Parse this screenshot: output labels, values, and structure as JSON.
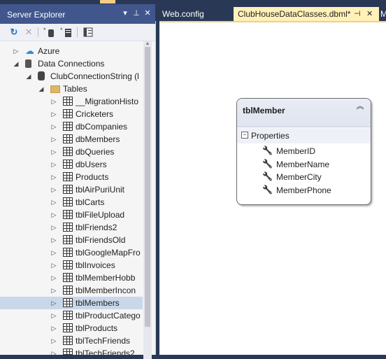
{
  "server_explorer": {
    "title": "Server Explorer",
    "title_buttons": [
      "▾",
      "⊥",
      "✕"
    ],
    "toolbar": [
      "refresh-icon",
      "stop-icon",
      "connect-db-icon",
      "connect-server-icon",
      "properties-icon"
    ],
    "tree": [
      {
        "label": "Azure",
        "level": 0,
        "expanded": false,
        "icon": "azure-icon"
      },
      {
        "label": "Data Connections",
        "level": 0,
        "expanded": true,
        "icon": "data-connections-icon"
      },
      {
        "label": "ClubConnectionString (l",
        "level": 1,
        "expanded": true,
        "icon": "database-icon"
      },
      {
        "label": "Tables",
        "level": 2,
        "expanded": true,
        "icon": "folder-icon"
      },
      {
        "label": "__MigrationHisto",
        "level": 3,
        "icon": "table-icon"
      },
      {
        "label": "Cricketers",
        "level": 3,
        "icon": "table-icon"
      },
      {
        "label": "dbCompanies",
        "level": 3,
        "icon": "table-icon"
      },
      {
        "label": "dbMembers",
        "level": 3,
        "icon": "table-icon"
      },
      {
        "label": "dbQueries",
        "level": 3,
        "icon": "table-icon"
      },
      {
        "label": "dbUsers",
        "level": 3,
        "icon": "table-icon"
      },
      {
        "label": "Products",
        "level": 3,
        "icon": "table-icon"
      },
      {
        "label": "tblAirPuriUnit",
        "level": 3,
        "icon": "table-icon"
      },
      {
        "label": "tblCarts",
        "level": 3,
        "icon": "table-icon"
      },
      {
        "label": "tblFileUpload",
        "level": 3,
        "icon": "table-icon"
      },
      {
        "label": "tblFriends2",
        "level": 3,
        "icon": "table-icon"
      },
      {
        "label": "tblFriendsOld",
        "level": 3,
        "icon": "table-icon"
      },
      {
        "label": "tblGoogleMapFro",
        "level": 3,
        "icon": "table-icon"
      },
      {
        "label": "tblInvoices",
        "level": 3,
        "icon": "table-icon"
      },
      {
        "label": "tblMemberHobb",
        "level": 3,
        "icon": "table-icon"
      },
      {
        "label": "tblMemberIncon",
        "level": 3,
        "icon": "table-icon"
      },
      {
        "label": "tblMembers",
        "level": 3,
        "icon": "table-icon",
        "selected": true
      },
      {
        "label": "tblProductCatego",
        "level": 3,
        "icon": "table-icon"
      },
      {
        "label": "tblProducts",
        "level": 3,
        "icon": "table-icon"
      },
      {
        "label": "tblTechFriends",
        "level": 3,
        "icon": "table-icon"
      },
      {
        "label": "tblTechFriends2",
        "level": 3,
        "icon": "table-icon"
      }
    ]
  },
  "tabs": {
    "web_config": "Web.config",
    "active": "ClubHouseDataClasses.dbml*",
    "pin": "⊣",
    "close": "✕",
    "overflow": "M"
  },
  "entity": {
    "name": "tblMember",
    "collapse_glyph": "︽",
    "section_toggle": "−",
    "section_label": "Properties",
    "properties": [
      "MemberID",
      "MemberName",
      "MemberCity",
      "MemberPhone"
    ]
  },
  "colors": {
    "title_bar": "#40568d",
    "ide_background": "#293955",
    "active_tab": "#fff1b8",
    "selected_row": "#c9d7ea"
  }
}
